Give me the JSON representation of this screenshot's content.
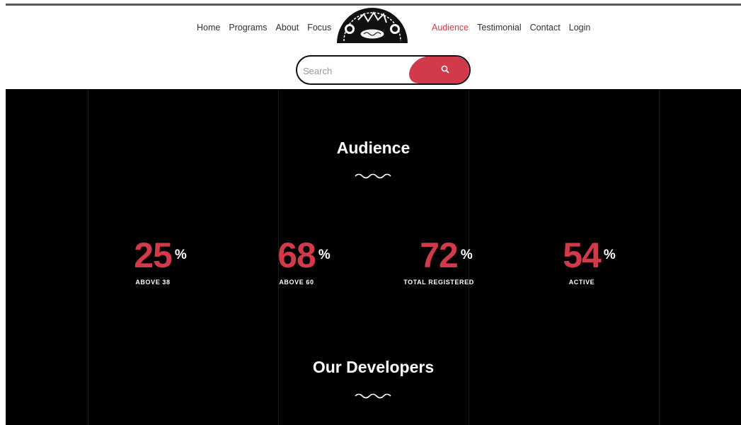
{
  "nav": {
    "left": [
      "Home",
      "Programs",
      "About",
      "Focus"
    ],
    "right": [
      "Audience",
      "Testimonial",
      "Contact",
      "Login"
    ],
    "active": "Audience"
  },
  "logo": {
    "icon": "theater-masks-logo"
  },
  "search": {
    "placeholder": "Search",
    "icon": "search-icon"
  },
  "audience": {
    "title": "Audience",
    "stats": [
      {
        "value": "25",
        "unit": "%",
        "label": "ABOVE 38"
      },
      {
        "value": "68",
        "unit": "%",
        "label": "ABOVE 60"
      },
      {
        "value": "72",
        "unit": "%",
        "label": "TOTAL REGISTERED"
      },
      {
        "value": "54",
        "unit": "%",
        "label": "ACTIVE"
      }
    ]
  },
  "developers": {
    "title": "Our Developers"
  },
  "colors": {
    "accent": "#d23a4c",
    "dark": "#000000",
    "text": "#333333"
  }
}
